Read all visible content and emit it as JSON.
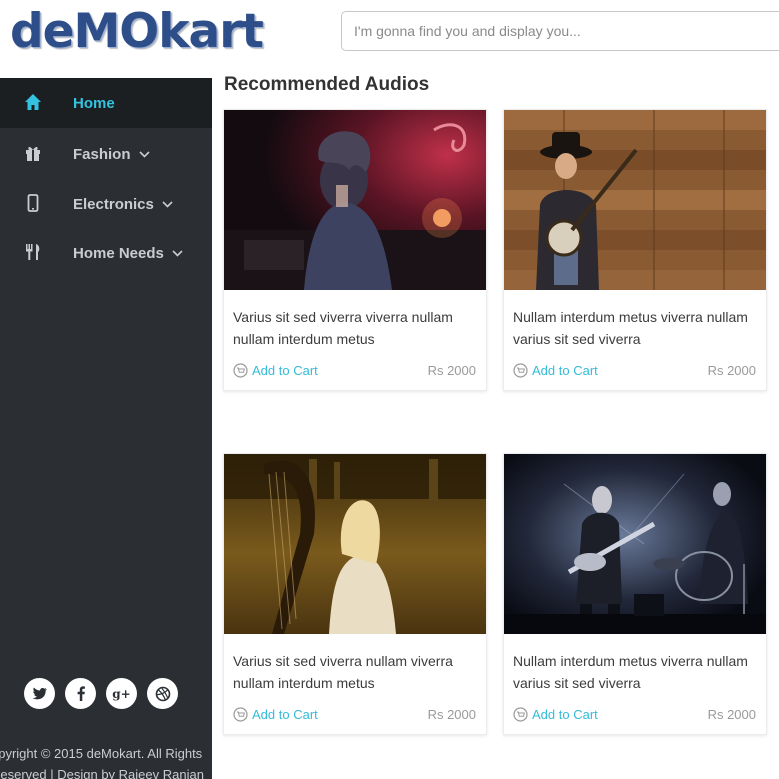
{
  "header": {
    "logo": "deMOkart",
    "search_placeholder": "I'm gonna find you and display you..."
  },
  "sidebar": {
    "items": [
      {
        "label": "Home",
        "icon": "home-icon",
        "active": true
      },
      {
        "label": "Fashion",
        "icon": "gift-icon",
        "has_dropdown": true
      },
      {
        "label": "Electronics",
        "icon": "mobile-icon",
        "has_dropdown": true
      },
      {
        "label": "Home Needs",
        "icon": "cutlery-icon",
        "has_dropdown": true
      }
    ],
    "social": [
      {
        "name": "twitter",
        "glyph": "t"
      },
      {
        "name": "facebook",
        "glyph": "f"
      },
      {
        "name": "google-plus",
        "glyph": "g+"
      },
      {
        "name": "dribbble",
        "glyph": "◎"
      }
    ],
    "copyright_line1": "opyright © 2015 deMokart. All Rights",
    "copyright_line2": "Reserved | Design by Rajeev Ranjan"
  },
  "main": {
    "section_title": "Recommended Audios",
    "products": [
      {
        "title": "Varius sit sed viverra viverra nullam nullam interdum metus",
        "cart_label": "Add to Cart",
        "price": "Rs 2000"
      },
      {
        "title": "Nullam interdum metus viverra nullam varius sit sed viverra",
        "cart_label": "Add to Cart",
        "price": "Rs 2000"
      },
      {
        "title": "Varius sit sed viverra nullam viverra nullam interdum metus",
        "cart_label": "Add to Cart",
        "price": "Rs 2000"
      },
      {
        "title": "Nullam interdum metus viverra nullam varius sit sed viverra",
        "cart_label": "Add to Cart",
        "price": "Rs 2000"
      }
    ]
  },
  "colors": {
    "accent": "#33c3e0",
    "sidebar_bg": "#2b2f33",
    "sidebar_active_bg": "#1c1f22",
    "logo": "#2e4e8a"
  }
}
